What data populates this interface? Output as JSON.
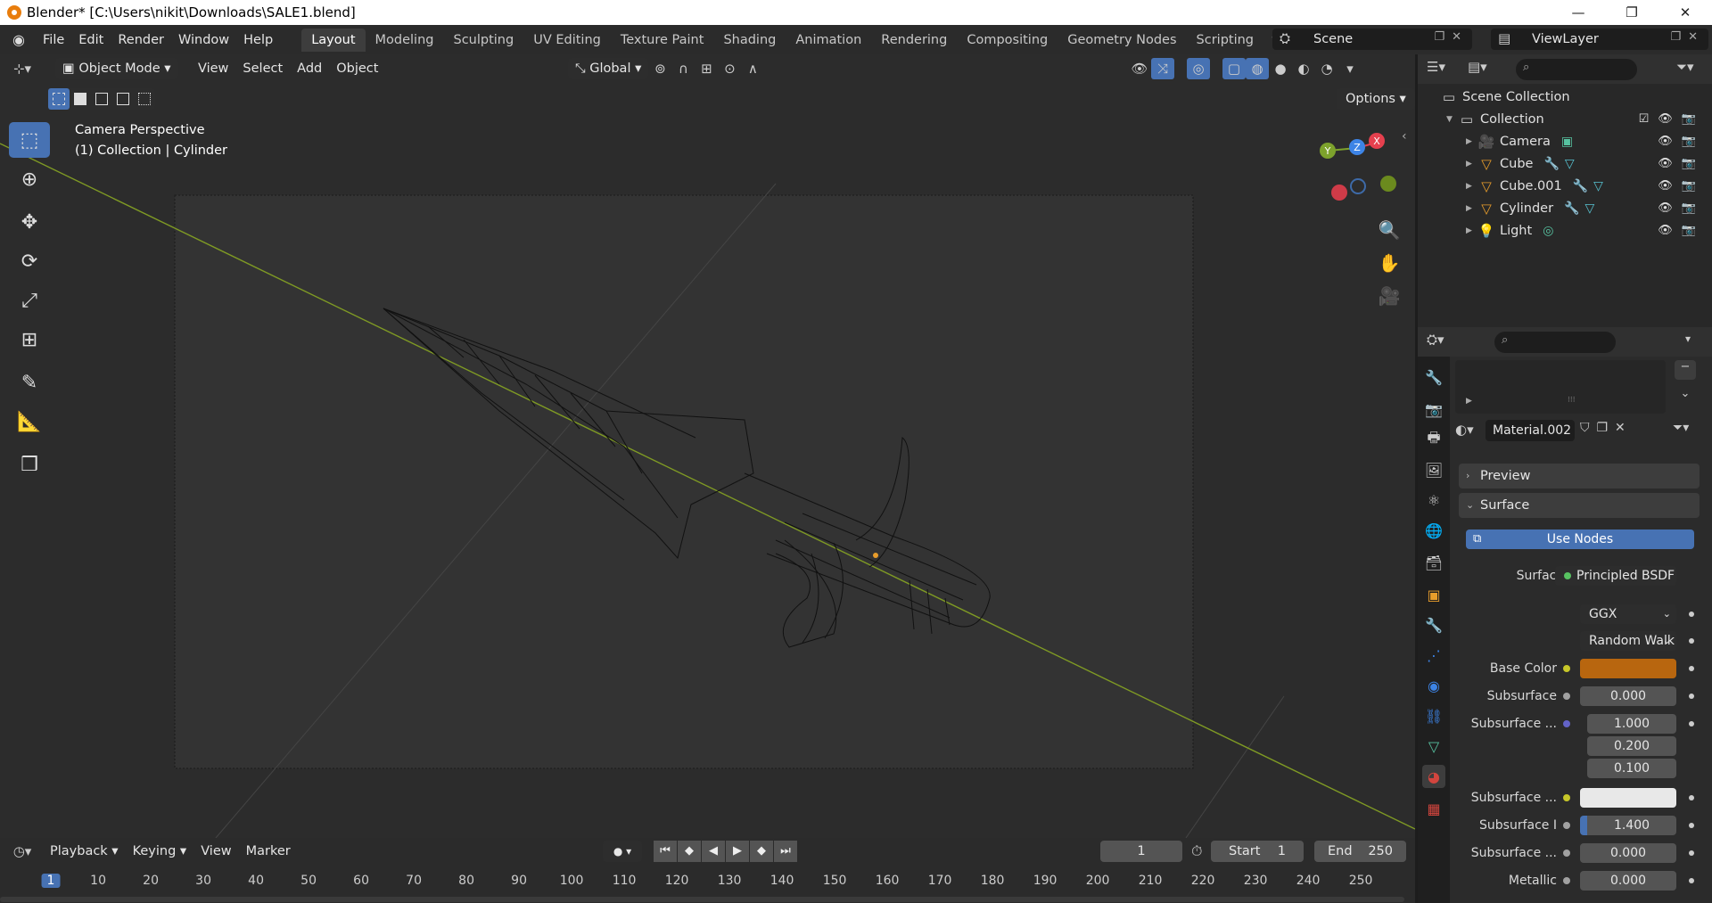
{
  "window": {
    "title": "Blender* [C:\\Users\\nikit\\Downloads\\SALE1.blend]",
    "controls": [
      "—",
      "❐",
      "✕"
    ]
  },
  "menu": [
    "File",
    "Edit",
    "Render",
    "Window",
    "Help"
  ],
  "workspaces": [
    "Layout",
    "Modeling",
    "Sculpting",
    "UV Editing",
    "Texture Paint",
    "Shading",
    "Animation",
    "Rendering",
    "Compositing",
    "Geometry Nodes",
    "Scripting"
  ],
  "active_workspace": "Layout",
  "scene": "Scene",
  "view_layer": "ViewLayer",
  "viewport": {
    "mode": "Object Mode",
    "menus": [
      "View",
      "Select",
      "Add",
      "Object"
    ],
    "transform_orientation": "Global",
    "options_label": "Options",
    "camera_label": "Camera Perspective",
    "collection_label": "(1) Collection | Cylinder",
    "gizmo_axes": [
      "X",
      "Y",
      "Z"
    ]
  },
  "timeline": {
    "menus": [
      "Playback",
      "Keying",
      "View",
      "Marker"
    ],
    "current_frame": "1",
    "start_label": "Start",
    "start": "1",
    "end_label": "End",
    "end": "250",
    "ruler_ticks": [
      "1",
      "10",
      "20",
      "30",
      "40",
      "50",
      "60",
      "70",
      "80",
      "90",
      "100",
      "110",
      "120",
      "130",
      "140",
      "150",
      "160",
      "170",
      "180",
      "190",
      "200",
      "210",
      "220",
      "230",
      "240",
      "250"
    ]
  },
  "outliner": {
    "root": "Scene Collection",
    "collection": "Collection",
    "objects": [
      "Camera",
      "Cube",
      "Cube.001",
      "Cylinder",
      "Light"
    ]
  },
  "properties": {
    "material_name": "Material.002",
    "panels": {
      "preview": "Preview",
      "surface": "Surface"
    },
    "use_nodes": "Use Nodes",
    "surface_label": "Surface",
    "surface_value": "Principled BSDF",
    "distribution": "GGX",
    "subsurface_method": "Random Walk",
    "rows": [
      {
        "label": "Base Color",
        "value": ""
      },
      {
        "label": "Subsurface",
        "value": "0.000"
      },
      {
        "label": "Subsurface ...",
        "value": "1.000"
      },
      {
        "label": "",
        "value": "0.200"
      },
      {
        "label": "",
        "value": "0.100"
      },
      {
        "label": "Subsurface ...",
        "value": ""
      },
      {
        "label": "Subsurface I",
        "value": "1.400"
      },
      {
        "label": "Subsurface ...",
        "value": "0.000"
      },
      {
        "label": "Metallic",
        "value": "0.000"
      }
    ]
  },
  "colors": {
    "accent": "#4772b3",
    "base_color": "#b8660f",
    "subsurface_color": "#e8e8e8",
    "axis_x": "#e5404e",
    "axis_y": "#7da22c",
    "axis_z": "#3d84e6"
  }
}
